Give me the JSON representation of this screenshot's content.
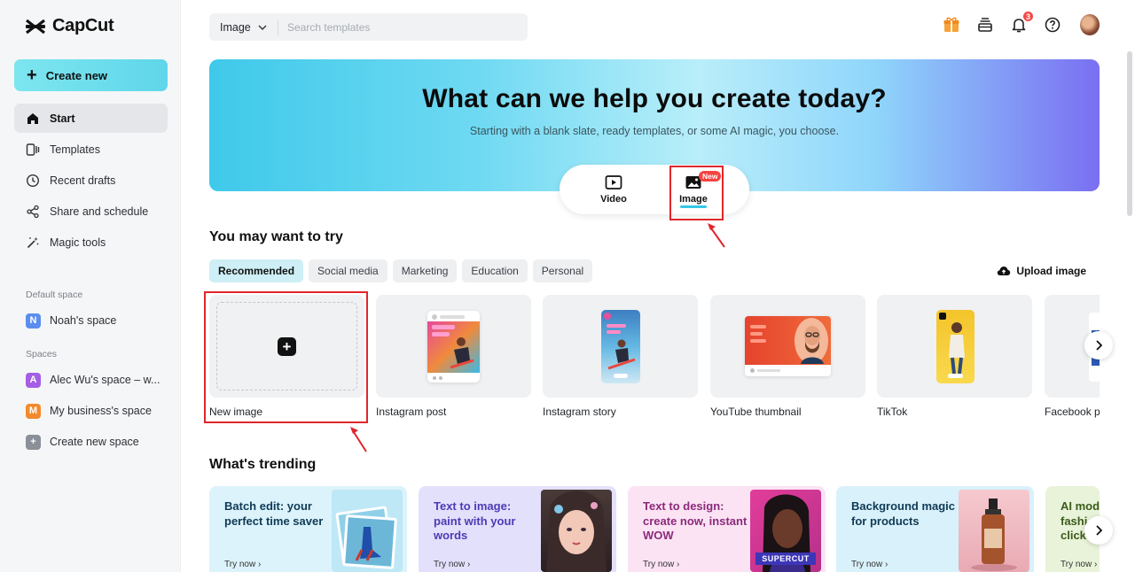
{
  "app": {
    "name": "CapCut"
  },
  "sidebar": {
    "create_label": "Create new",
    "nav": [
      {
        "label": "Start",
        "icon": "home-icon",
        "active": true
      },
      {
        "label": "Templates",
        "icon": "templates-icon"
      },
      {
        "label": "Recent drafts",
        "icon": "clock-icon"
      },
      {
        "label": "Share and schedule",
        "icon": "share-icon"
      },
      {
        "label": "Magic tools",
        "icon": "magic-wand-icon"
      }
    ],
    "default_space_title": "Default space",
    "default_space": {
      "initial": "N",
      "label": "Noah's space",
      "color": "#5b8def"
    },
    "spaces_title": "Spaces",
    "spaces": [
      {
        "initial": "A",
        "label": "Alec Wu's space – w...",
        "color": "#a45ee5"
      },
      {
        "initial": "M",
        "label": "My business's space",
        "color": "#f28a2e"
      },
      {
        "initial": "+",
        "label": "Create new space",
        "color": "#8a8f98"
      }
    ]
  },
  "search": {
    "type_value": "Image",
    "placeholder": "Search templates"
  },
  "header": {
    "notification_count": "3"
  },
  "hero": {
    "title": "What can we help you create today?",
    "subtitle": "Starting with a blank slate, ready templates, or some AI magic, you choose.",
    "modes": [
      {
        "label": "Video"
      },
      {
        "label": "Image",
        "badge": "New",
        "selected": true
      }
    ]
  },
  "try_section": {
    "title": "You may want to try",
    "chips": [
      "Recommended",
      "Social media",
      "Marketing",
      "Education",
      "Personal"
    ],
    "active_chip": "Recommended",
    "upload_label": "Upload image",
    "cards": [
      "New image",
      "Instagram post",
      "Instagram story",
      "YouTube thumbnail",
      "TikTok",
      "Facebook p"
    ]
  },
  "trending": {
    "title": "What's trending",
    "cards": [
      {
        "title": "Batch edit: your perfect time saver",
        "try": "Try now ›",
        "bg": "#dcf3fb",
        "color": "#0f3a55"
      },
      {
        "title": "Text to image: paint with your words",
        "try": "Try now ›",
        "bg": "#e3e0fb",
        "color": "#4b3bb5"
      },
      {
        "title": "Text to design: create now, instant WOW",
        "try": "Try now ›",
        "bg": "#fbe3f4",
        "color": "#8b2a7a"
      },
      {
        "title": "Background magic for products",
        "try": "Try now ›",
        "bg": "#d9f1fb",
        "color": "#0f3a55"
      },
      {
        "title": "AI mod fashi click",
        "try": "Try now ›",
        "bg": "#e8f3d9",
        "color": "#3b5b1a"
      }
    ],
    "supercut_label": "SUPERCUT"
  },
  "colors": {
    "accent": "#35c8e6",
    "highlight": "#e0262c",
    "badge": "#f54a45"
  }
}
